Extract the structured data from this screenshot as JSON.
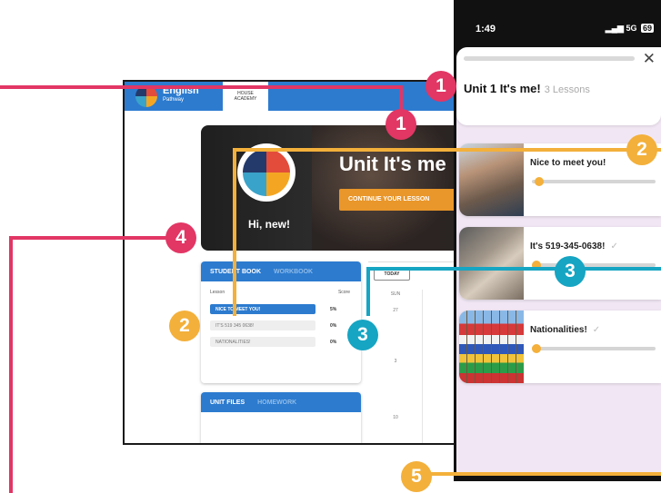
{
  "colors": {
    "pink": "#e23665",
    "orange": "#f3b03a",
    "teal": "#16a5c3",
    "desktop_blue": "#2c7bcf",
    "button_orange": "#e9962a",
    "sheet_lavender": "#f1e7f4"
  },
  "desktop": {
    "brand_name": "English",
    "brand_sub": "Pathway",
    "tab_line1": "HOUSE",
    "tab_line2": "ACADEMY",
    "hero": {
      "title": "Unit It's me",
      "greeting": "Hi, new!",
      "continue_button": "CONTINUE YOUR LESSON"
    },
    "book_panel": {
      "tab_active": "STUDENT BOOK",
      "tab_inactive": "WORKBOOK",
      "col_lesson": "Lesson",
      "col_score": "Score",
      "rows": [
        {
          "name": "NICE TO MEET YOU!",
          "score": "5%"
        },
        {
          "name": "IT'S 519 345 0638!",
          "score": "0%"
        },
        {
          "name": "NATIONALITIES!",
          "score": "0%"
        }
      ]
    },
    "files_panel": {
      "tab_active": "UNIT FILES",
      "tab_inactive": "HOMEWORK"
    },
    "calendar": {
      "today_button": "TODAY",
      "day_header": "SUN",
      "dates": [
        "27",
        "3",
        "10"
      ]
    }
  },
  "phone": {
    "status": {
      "time": "1:49",
      "network": "5G",
      "battery": "69"
    },
    "unit_title": "Unit 1 It's me!",
    "lesson_count": "3 Lessons",
    "lessons": [
      {
        "title": "Nice to meet you!",
        "check": "",
        "progress": 0.02
      },
      {
        "title": "It's 519-345-0638!",
        "check": "✓",
        "progress": 0.0
      },
      {
        "title": "Nationalities!",
        "check": "✓",
        "progress": 0.0
      }
    ]
  },
  "annotations": [
    {
      "label": "1",
      "color": "pink"
    },
    {
      "label": "1",
      "color": "pink"
    },
    {
      "label": "2",
      "color": "orange"
    },
    {
      "label": "2",
      "color": "orange"
    },
    {
      "label": "3",
      "color": "teal"
    },
    {
      "label": "3",
      "color": "teal"
    },
    {
      "label": "4",
      "color": "pink"
    },
    {
      "label": "5",
      "color": "orange"
    }
  ]
}
